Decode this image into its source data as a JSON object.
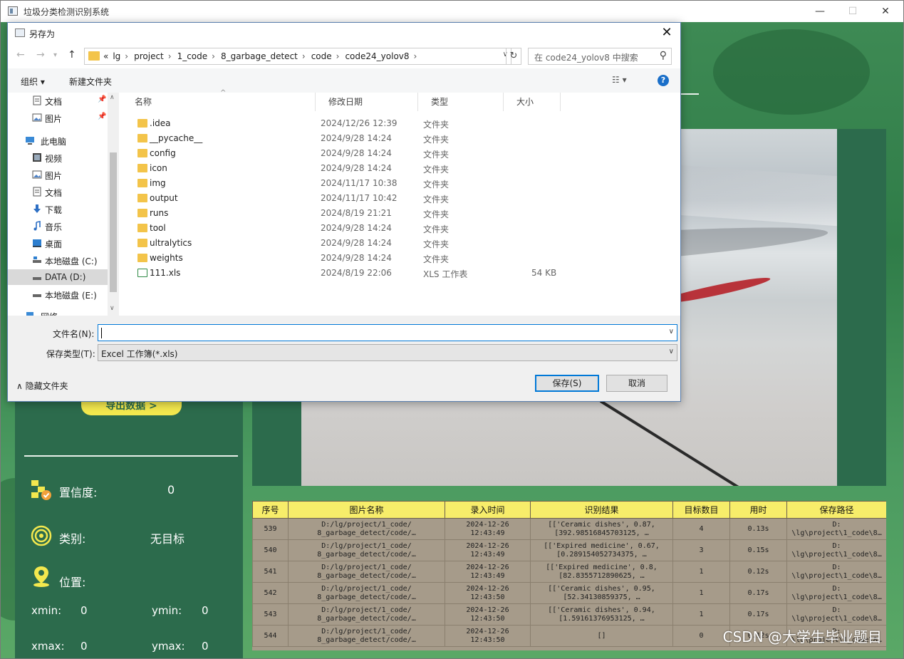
{
  "app": {
    "title": "垃圾分类检测识别系统",
    "controls": {
      "minimize": "—",
      "maximize": "☐",
      "close": "✕"
    }
  },
  "left_panel": {
    "export_button": "导出数据 >",
    "confidence": {
      "label": "置信度:",
      "value": "0"
    },
    "category": {
      "label": "类别:",
      "value": "无目标"
    },
    "position": {
      "label": "位置:"
    },
    "coords": {
      "xmin_label": "xmin:",
      "xmin": "0",
      "ymin_label": "ymin:",
      "ymin": "0",
      "xmax_label": "xmax:",
      "xmax": "0",
      "ymax_label": "ymax:",
      "ymax": "0"
    }
  },
  "table": {
    "headers": [
      "序号",
      "图片名称",
      "录入时间",
      "识别结果",
      "目标数目",
      "用时",
      "保存路径"
    ],
    "rows": [
      [
        "539",
        "D:/lg/project/1_code/\n8_garbage_detect/code/…",
        "2024-12-26\n12:43:49",
        "[['Ceramic dishes', 0.87,\n[392.98516845703125, …",
        "4",
        "0.13s",
        "D:\n\\lg\\project\\1_code\\8…"
      ],
      [
        "540",
        "D:/lg/project/1_code/\n8_garbage_detect/code/…",
        "2024-12-26\n12:43:49",
        "[['Expired medicine', 0.67,\n[0.289154052734375, …",
        "3",
        "0.15s",
        "D:\n\\lg\\project\\1_code\\8…"
      ],
      [
        "541",
        "D:/lg/project/1_code/\n8_garbage_detect/code/…",
        "2024-12-26\n12:43:49",
        "[['Expired medicine', 0.8,\n[82.8355712890625, …",
        "1",
        "0.12s",
        "D:\n\\lg\\project\\1_code\\8…"
      ],
      [
        "542",
        "D:/lg/project/1_code/\n8_garbage_detect/code/…",
        "2024-12-26\n12:43:50",
        "[['Ceramic dishes', 0.95,\n[52.34130859375, …",
        "1",
        "0.17s",
        "D:\n\\lg\\project\\1_code\\8…"
      ],
      [
        "543",
        "D:/lg/project/1_code/\n8_garbage_detect/code/…",
        "2024-12-26\n12:43:50",
        "[['Ceramic dishes', 0.94,\n[1.59161376953125, …",
        "1",
        "0.17s",
        "D:\n\\lg\\project\\1_code\\8…"
      ],
      [
        "544",
        "D:/lg/project/1_code/\n8_garbage_detect/code/…",
        "2024-12-26\n12:43:50",
        "[]",
        "0",
        "0.12s",
        "D:\n\\lg\\project\\1_code\\8…"
      ]
    ]
  },
  "watermark": "CSDN @大学生毕业题目",
  "dialog": {
    "title": "另存为",
    "close": "✕",
    "breadcrumbs": [
      "«",
      "lg",
      "project",
      "1_code",
      "8_garbage_detect",
      "code",
      "code24_yolov8"
    ],
    "search_placeholder": "在 code24_yolov8 中搜索",
    "toolbar": {
      "organize": "组织 ▾",
      "new_folder": "新建文件夹",
      "help": "?"
    },
    "nav_items": [
      {
        "label": "文档",
        "icon": "document-icon",
        "pinned": true
      },
      {
        "label": "图片",
        "icon": "pictures-icon",
        "pinned": true
      },
      {
        "label": "此电脑",
        "icon": "computer-icon"
      },
      {
        "label": "视频",
        "icon": "video-icon"
      },
      {
        "label": "图片",
        "icon": "pictures-icon"
      },
      {
        "label": "文档",
        "icon": "document-icon"
      },
      {
        "label": "下载",
        "icon": "download-icon"
      },
      {
        "label": "音乐",
        "icon": "music-icon"
      },
      {
        "label": "桌面",
        "icon": "desktop-icon"
      },
      {
        "label": "本地磁盘 (C:)",
        "icon": "drive-icon"
      },
      {
        "label": "DATA (D:)",
        "icon": "drive-icon",
        "selected": true
      },
      {
        "label": "本地磁盘 (E:)",
        "icon": "drive-icon"
      },
      {
        "label": "网络",
        "icon": "network-icon"
      }
    ],
    "columns": {
      "name": "名称",
      "modified": "修改日期",
      "type": "类型",
      "size": "大小"
    },
    "files": [
      {
        "name": ".idea",
        "modified": "2024/12/26 12:39",
        "type": "文件夹",
        "size": ""
      },
      {
        "name": "__pycache__",
        "modified": "2024/9/28 14:24",
        "type": "文件夹",
        "size": ""
      },
      {
        "name": "config",
        "modified": "2024/9/28 14:24",
        "type": "文件夹",
        "size": ""
      },
      {
        "name": "icon",
        "modified": "2024/9/28 14:24",
        "type": "文件夹",
        "size": ""
      },
      {
        "name": "img",
        "modified": "2024/11/17 10:38",
        "type": "文件夹",
        "size": ""
      },
      {
        "name": "output",
        "modified": "2024/11/17 10:42",
        "type": "文件夹",
        "size": ""
      },
      {
        "name": "runs",
        "modified": "2024/8/19 21:21",
        "type": "文件夹",
        "size": ""
      },
      {
        "name": "tool",
        "modified": "2024/9/28 14:24",
        "type": "文件夹",
        "size": ""
      },
      {
        "name": "ultralytics",
        "modified": "2024/9/28 14:24",
        "type": "文件夹",
        "size": ""
      },
      {
        "name": "weights",
        "modified": "2024/9/28 14:24",
        "type": "文件夹",
        "size": ""
      },
      {
        "name": "111.xls",
        "modified": "2024/8/19 22:06",
        "type": "XLS 工作表",
        "size": "54 KB",
        "xls": true
      }
    ],
    "filename_label": "文件名(N):",
    "filename_value": "",
    "filetype_label": "保存类型(T):",
    "filetype_value": "Excel 工作簿(*.xls)",
    "hide_folders": "隐藏文件夹",
    "save": "保存(S)",
    "cancel": "取消"
  }
}
